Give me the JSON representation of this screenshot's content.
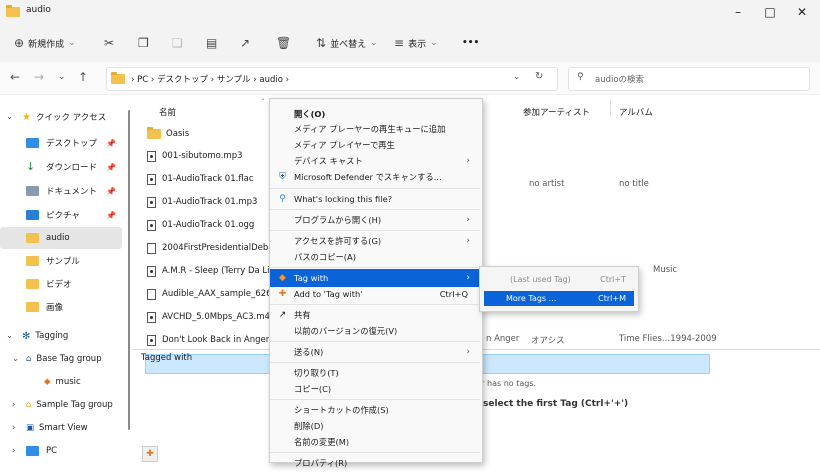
{
  "window": {
    "title": "audio"
  },
  "toolbar": {
    "new": "新規作成",
    "sort": "並べ替え",
    "view": "表示",
    "more": "•••"
  },
  "address": {
    "path": [
      "PC",
      "デスクトップ",
      "サンプル",
      "audio"
    ],
    "search_placeholder": "audioの検索"
  },
  "sidebar": {
    "quick_access": "クイック アクセス",
    "items": [
      "デスクトップ",
      "ダウンロード",
      "ドキュメント",
      "ピクチャ",
      "audio",
      "サンプル",
      "ビデオ",
      "画像"
    ],
    "tagging": "Tagging",
    "base_tag_group": "Base Tag group",
    "music": "music",
    "sample_tag_group": "Sample Tag group",
    "smart_view": "Smart View",
    "pc": "PC"
  },
  "columns": {
    "name": "名前",
    "artist": "参加アーティスト",
    "album": "アルバム"
  },
  "files": [
    {
      "name": "Oasis",
      "artist": "",
      "album": ""
    },
    {
      "name": "001-sibutomo.mp3",
      "artist": "",
      "album": ""
    },
    {
      "name": "01-AudioTrack 01.flac",
      "artist": "no artist",
      "album": "no title"
    },
    {
      "name": "01-AudioTrack 01.mp3",
      "artist": "",
      "album": ""
    },
    {
      "name": "01-AudioTrack 01.ogg",
      "artist": "",
      "album": ""
    },
    {
      "name": "2004FirstPresidentialDebate",
      "artist": "",
      "album": ""
    },
    {
      "name": "A.M.R - Sleep (Terry Da Libr",
      "artist": "",
      "album": "Music"
    },
    {
      "name": "Audible_AAX_sample_62689",
      "artist": "",
      "album": ""
    },
    {
      "name": "AVCHD_5.0Mbps_AC3.m4a",
      "artist": "",
      "album": ""
    },
    {
      "name": "Don't Look Back in Anger.m",
      "artist_prefix": "n Anger",
      "artist": "オアシス",
      "album": "Time Flies…1994-2009"
    }
  ],
  "tag_panel": {
    "title": "Tagged with",
    "no_tags": "lder has no tags.",
    "hint": "select the first Tag (Ctrl+'+')"
  },
  "context_menu": {
    "open": "開く(O)",
    "add_queue": "メディア プレーヤーの再生キューに追加",
    "play": "メディア プレイヤーで再生",
    "cast": "デバイス キャスト",
    "defender": "Microsoft Defender でスキャンする...",
    "locking": "What's locking this file?",
    "open_with": "プログラムから開く(H)",
    "access": "アクセスを許可する(G)",
    "copy_path": "パスのコピー(A)",
    "tag_with": "Tag with",
    "add_to_tag": "Add to 'Tag with'",
    "add_to_tag_shortcut": "Ctrl+Q",
    "share": "共有",
    "restore": "以前のバージョンの復元(V)",
    "send_to": "送る(N)",
    "cut": "切り取り(T)",
    "copy": "コピー(C)",
    "shortcut": "ショートカットの作成(S)",
    "delete": "削除(D)",
    "rename": "名前の変更(M)",
    "properties": "プロパティ(R)"
  },
  "submenu": {
    "last_used": "(Last used Tag)",
    "last_used_shortcut": "Ctrl+T",
    "more": "More Tags ...",
    "more_shortcut": "Ctrl+M"
  }
}
